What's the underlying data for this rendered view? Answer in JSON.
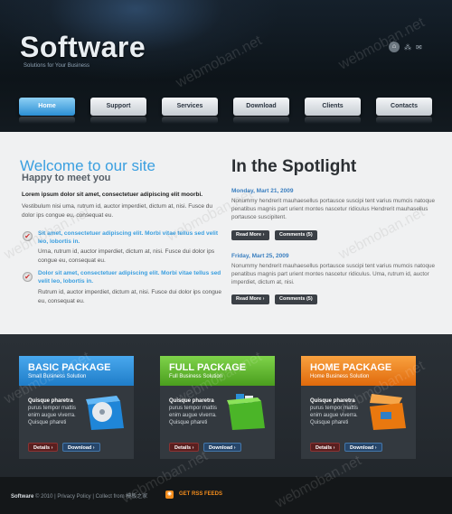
{
  "header": {
    "logo": "Software",
    "tagline": "Solutions for Your Business",
    "icons": [
      "home-icon",
      "sitemap-icon",
      "email-icon"
    ]
  },
  "nav": [
    "Home",
    "Support",
    "Services",
    "Download",
    "Clients",
    "Contacts"
  ],
  "welcome": {
    "title": "Welcome to our site",
    "subtitle": "Happy to meet you",
    "lead": "Lorem ipsum dolor sit amet, consectetuer adipiscing elit moorbi.",
    "intro": "Vestibulum nisi uma, rutrum id, auctor imperdiet, dictum at, nisi. Fusce du dolor ips congue eu, consequat eu.",
    "bullets": [
      {
        "title": "Sit amet, consectetuer adipiscing elit. Morbi vitae tellus sed velit leo, lobortis in.",
        "text": "Urna, rutrum id, auctor imperdiet, dictum at, nisi. Fusce dui dolor ips congue eu, consequat eu."
      },
      {
        "title": "Dolor sit amet, consectetuer adipiscing elit. Morbi vitae tellus sed velit leo, lobortis in.",
        "text": "Rutrum id, auctor imperdiet, dictum at, nisi. Fusce dui dolor ips congue eu, consequat eu."
      }
    ]
  },
  "spotlight": {
    "title": "In the Spotlight",
    "posts": [
      {
        "date": "Monday, Mart 21, 2009",
        "text": "Nonummy hendrerit mauhaesellus portausce suscipi tent varius mumcis natoque penatibus magnis part urient montes nascetur ridiculus Hendrerit mauhasellus portausce suscipitent.",
        "more": "Read More",
        "comments": "Comments (5)"
      },
      {
        "date": "Friday, Mart 25, 2009",
        "text": "Nonummy hendrerit mauhaesellus portausce suscipi tent varius mumcis natoque penatibus magnis part urient montes nascetur ridiculus. Uma, rutrum id, auctor imperdiet, dictum at, nisi.",
        "more": "Read More",
        "comments": "Comments (5)"
      }
    ]
  },
  "packages": [
    {
      "title": "BASIC PACKAGE",
      "sub": "Small Business Solution",
      "lead": "Quisque pharetra",
      "text": "purus tempor mattis enim augue viverra. Quisque phareti",
      "details": "Details",
      "download": "Download",
      "color": "#2b8fd9",
      "icon": "cd-box-icon"
    },
    {
      "title": "FULL PACKAGE",
      "sub": "Full Business Solution",
      "lead": "Quisque pharetra",
      "text": "purus tempor mattis enim augue viverra. Quisque phareti",
      "details": "Details",
      "download": "Download",
      "color": "#5bb52a",
      "icon": "files-box-icon"
    },
    {
      "title": "HOME PACKAGE",
      "sub": "Home Business Solution",
      "lead": "Quisque pharetra",
      "text": "purus tempor mattis enim augue viverra. Quisque phareti",
      "details": "Details",
      "download": "Download",
      "color": "#ef7a16",
      "icon": "tools-box-icon"
    }
  ],
  "footer": {
    "brand": "Software",
    "text": "© 2010 | Privacy Policy | Collect from 模板之家",
    "rss": "GET RSS FEEDS"
  },
  "watermark": "webmoban.net"
}
